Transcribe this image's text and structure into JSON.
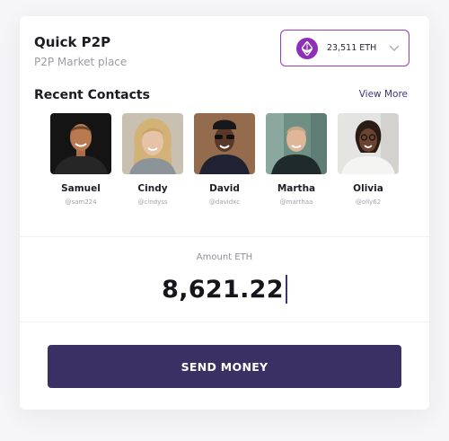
{
  "header": {
    "title": "Quick P2P",
    "subtitle": "P2P Market place"
  },
  "wallet": {
    "balance": "23,511 ETH",
    "icon": "ethereum-icon",
    "accent": "#8e2fb7"
  },
  "contacts_section": {
    "title": "Recent Contacts",
    "view_more": "View More",
    "items": [
      {
        "name": "Samuel",
        "handle": "@sam224"
      },
      {
        "name": "Cindy",
        "handle": "@cindyss"
      },
      {
        "name": "David",
        "handle": "@davidxc"
      },
      {
        "name": "Martha",
        "handle": "@marthaa"
      },
      {
        "name": "Olivia",
        "handle": "@olly62"
      }
    ]
  },
  "transfer": {
    "amount_label": "Amount ETH",
    "amount_value": "8,621.22",
    "send_label": "SEND MONEY",
    "button_color": "#3b3063"
  }
}
